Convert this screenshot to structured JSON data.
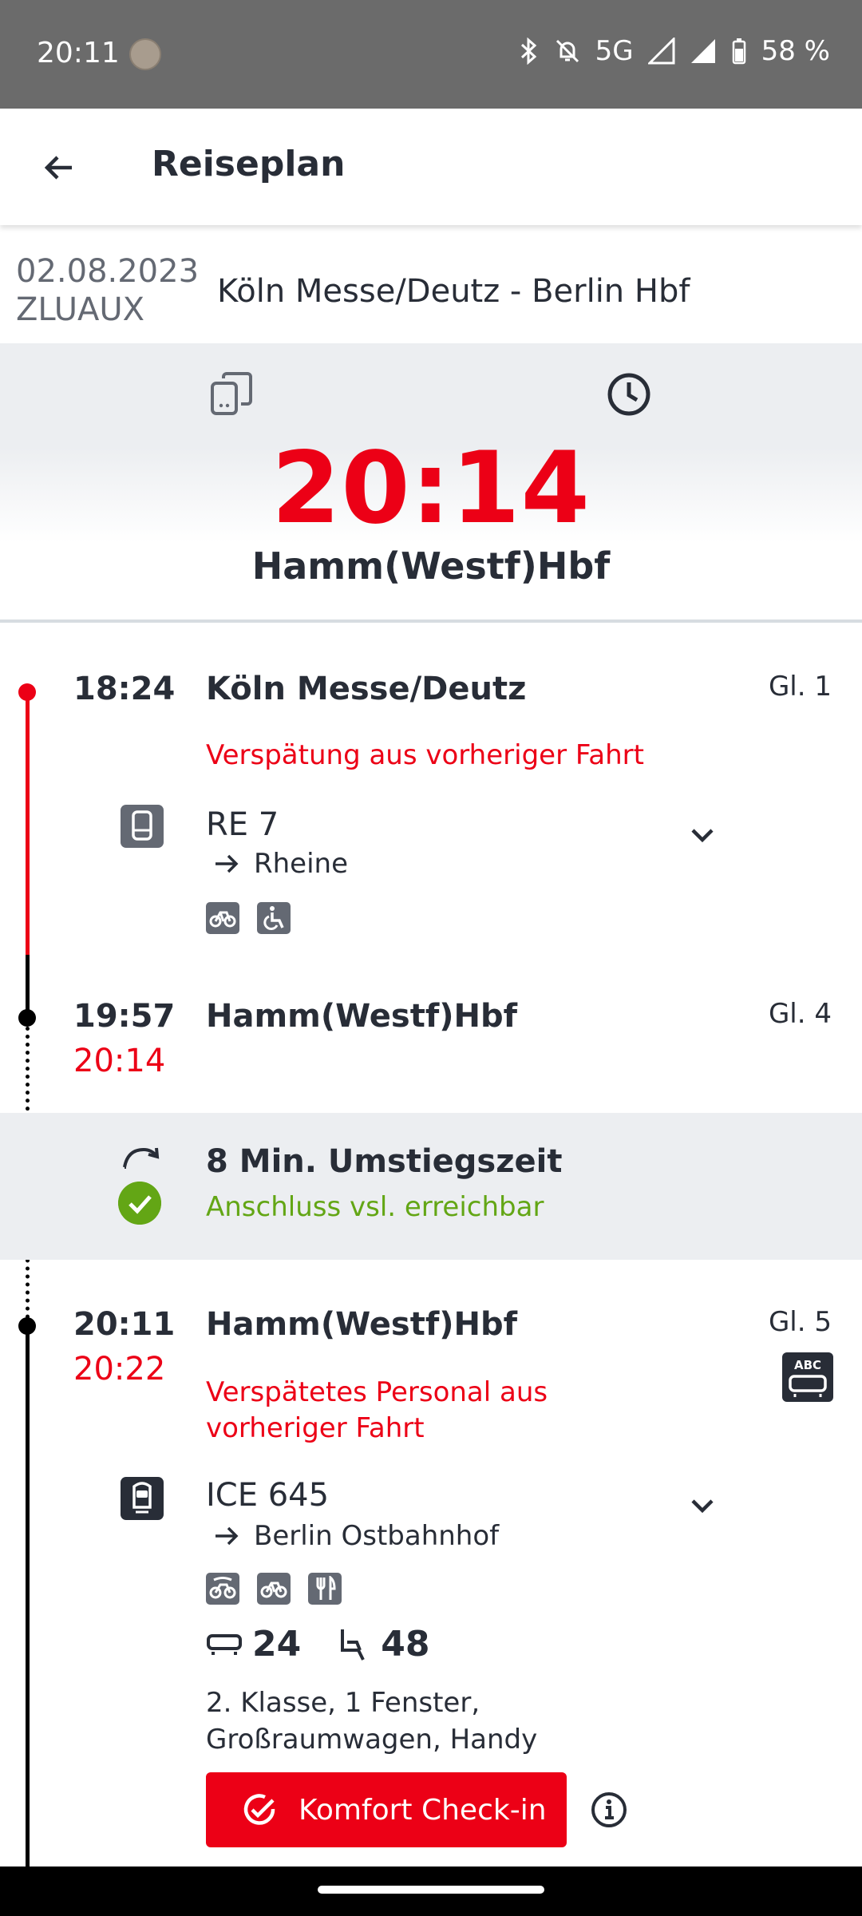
{
  "status_bar": {
    "time": "20:11",
    "network": "5G",
    "battery": "58 %",
    "icons": [
      "bluetooth-icon",
      "notifications-off-icon",
      "signal-icon",
      "battery-icon"
    ]
  },
  "app_bar": {
    "title": "Reiseplan",
    "back_icon": "arrow-back-icon"
  },
  "trip": {
    "date": "02.08.2023",
    "code": "ZLUAUX",
    "route": "Köln Messe/Deutz - Berlin Hbf"
  },
  "next": {
    "time": "20:14",
    "station": "Hamm(Westf)Hbf",
    "icons": [
      "phone-device-icon",
      "clock-icon"
    ]
  },
  "stops": [
    {
      "time": "18:24",
      "station": "Köln Messe/Deutz",
      "track": "Gl. 1",
      "notice": "Verspätung aus vorheriger Fahrt",
      "train": "RE 7",
      "direction": "Rheine",
      "amenities": [
        "bicycle-icon",
        "wheelchair-icon"
      ]
    },
    {
      "time": "19:57",
      "delay": "20:14",
      "station": "Hamm(Westf)Hbf",
      "track": "Gl. 4"
    },
    {
      "time": "20:11",
      "delay": "20:22",
      "station": "Hamm(Westf)Hbf",
      "track": "Gl. 5",
      "notice_line1": "Verspätetes Personal aus",
      "notice_line2": "vorheriger Fahrt",
      "train": "ICE 645",
      "direction": "Berlin Ostbahnhof",
      "amenities": [
        "bicycle-reservation-icon",
        "bicycle-icon",
        "restaurant-icon"
      ],
      "wagon": "24",
      "seat": "48",
      "seat_info_line1": "2. Klasse, 1 Fenster,",
      "seat_info_line2": "Großraumwagen, Handy",
      "checkin_label": "Komfort Check-in"
    }
  ],
  "transfer": {
    "title": "8 Min. Umstiegszeit",
    "status": "Anschluss vsl. erreichbar"
  },
  "colors": {
    "accent_red": "#ec0016",
    "green": "#63a615",
    "text": "#282d37"
  }
}
